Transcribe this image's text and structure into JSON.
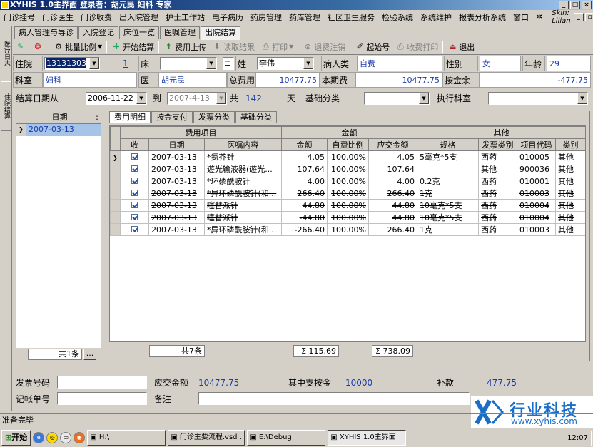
{
  "window": {
    "title": "XYHIS 1.0主界面   登录者：胡元民  妇科  专家"
  },
  "menu": [
    "门诊挂号",
    "门诊医生",
    "门诊收费",
    "出入院管理",
    "护士工作站",
    "电子病历",
    "药房管理",
    "药库管理",
    "社区卫生服务",
    "检验系统",
    "系统维护",
    "报表分析系统",
    "窗口"
  ],
  "skin": "Skin: Lilian",
  "side_tabs": [
    "医疗日志",
    "住院结算"
  ],
  "tabs": [
    "病人管理与导诊",
    "入院登记",
    "床位一览",
    "医嘱管理",
    "出院结算"
  ],
  "toolbar": {
    "batch": "批量比例",
    "start": "开始结算",
    "upload": "费用上传",
    "read": "读取结果",
    "print": "打印",
    "refund": "退费注销",
    "start_no": "起始号",
    "receipt": "收费打印",
    "exit": "退出"
  },
  "form": {
    "inpatient_label": "住院",
    "inpatient_value": "13131303",
    "bed_count": "1",
    "bed_label": "床",
    "name_label": "姓",
    "name_value": "李伟",
    "patient_type_label": "病人类",
    "patient_type_value": "自费",
    "sex_label": "性别",
    "sex_value": "女",
    "age_label": "年龄",
    "age_value": "29",
    "dept_label": "科室",
    "dept_value": "妇科",
    "doctor_label": "医",
    "doctor_value": "胡元民",
    "total_label": "总费用",
    "total_value": "10477.75",
    "period_label": "本期费",
    "period_value": "10477.75",
    "deposit_label": "按金余",
    "deposit_value": "-477.75",
    "date_from_label": "结算日期从",
    "date_from": "2006-11-22",
    "to_label": "到",
    "date_to": "2007-4-13",
    "total_days_label": "共",
    "days": "142",
    "days_unit": "天",
    "base_cat_label": "基础分类",
    "exec_dept_label": "执行科室"
  },
  "left_table": {
    "header": "日期",
    "rows": [
      "2007-03-13"
    ],
    "footer": "共1条",
    "more": "..."
  },
  "subtabs": [
    "费用明细",
    "按金支付",
    "发票分类",
    "基础分类"
  ],
  "fee_table": {
    "group_headers": {
      "fee_item": "费用项目",
      "amount": "金额",
      "other": "其他"
    },
    "columns": [
      "收",
      "日期",
      "医嘱内容",
      "金额",
      "自费比例",
      "应交金额",
      "规格",
      "发票类别",
      "项目代码",
      "类别"
    ],
    "rows": [
      {
        "date": "2007-03-13",
        "content": "*氨芥针",
        "amount": "4.05",
        "ratio": "100.00%",
        "due": "4.05",
        "spec": "5毫克*5支",
        "invoice": "西药",
        "code": "010005",
        "cat": "其他",
        "struck": false
      },
      {
        "date": "2007-03-13",
        "content": "遊光输液器(遊光...",
        "amount": "107.64",
        "ratio": "100.00%",
        "due": "107.64",
        "spec": "",
        "invoice": "其他",
        "code": "900036",
        "cat": "其他",
        "struck": false
      },
      {
        "date": "2007-03-13",
        "content": "*环磷酰胺针",
        "amount": "4.00",
        "ratio": "100.00%",
        "due": "4.00",
        "spec": "0.2克",
        "invoice": "西药",
        "code": "010001",
        "cat": "其他",
        "struck": false
      },
      {
        "date": "2007-03-13",
        "content": "*异环磷酰胺针(和...",
        "amount": "266.40",
        "ratio": "100.00%",
        "due": "266.40",
        "spec": "1克",
        "invoice": "西药",
        "code": "010003",
        "cat": "其他",
        "struck": true
      },
      {
        "date": "2007-03-13",
        "content": "噻替派针",
        "amount": "44.80",
        "ratio": "100.00%",
        "due": "44.80",
        "spec": "10毫克*5支",
        "invoice": "西药",
        "code": "010004",
        "cat": "其他",
        "struck": true
      },
      {
        "date": "2007-03-13",
        "content": "噻替派针",
        "amount": "-44.80",
        "ratio": "100.00%",
        "due": "44.80",
        "spec": "10毫克*5支",
        "invoice": "西药",
        "code": "010004",
        "cat": "其他",
        "struck": true
      },
      {
        "date": "2007-03-13",
        "content": "*异环磷酰胺针(和...",
        "amount": "-266.40",
        "ratio": "100.00%",
        "due": "266.40",
        "spec": "1克",
        "invoice": "西药",
        "code": "010003",
        "cat": "其他",
        "struck": true
      }
    ],
    "footer_count": "共7条",
    "footer_amount": "Σ 115.69",
    "footer_due": "Σ 738.09"
  },
  "bottom": {
    "invoice_no_label": "发票号码",
    "due_label": "应交金额",
    "due_value": "10477.75",
    "paid_label": "其中支按金",
    "paid_value": "10000",
    "refund_label": "补款",
    "refund_value": "477.75",
    "account_label": "记帐单号",
    "note_label": "备注"
  },
  "status": "准备完毕",
  "taskbar": {
    "start": "开始",
    "tasks": [
      "H:\\",
      "门诊主要流程.vsd ...",
      "E:\\Debug",
      "XYHIS 1.0主界面"
    ],
    "clock": "12:07"
  },
  "watermark": {
    "brand": "行业科技",
    "url": "www.xyhis.com"
  }
}
